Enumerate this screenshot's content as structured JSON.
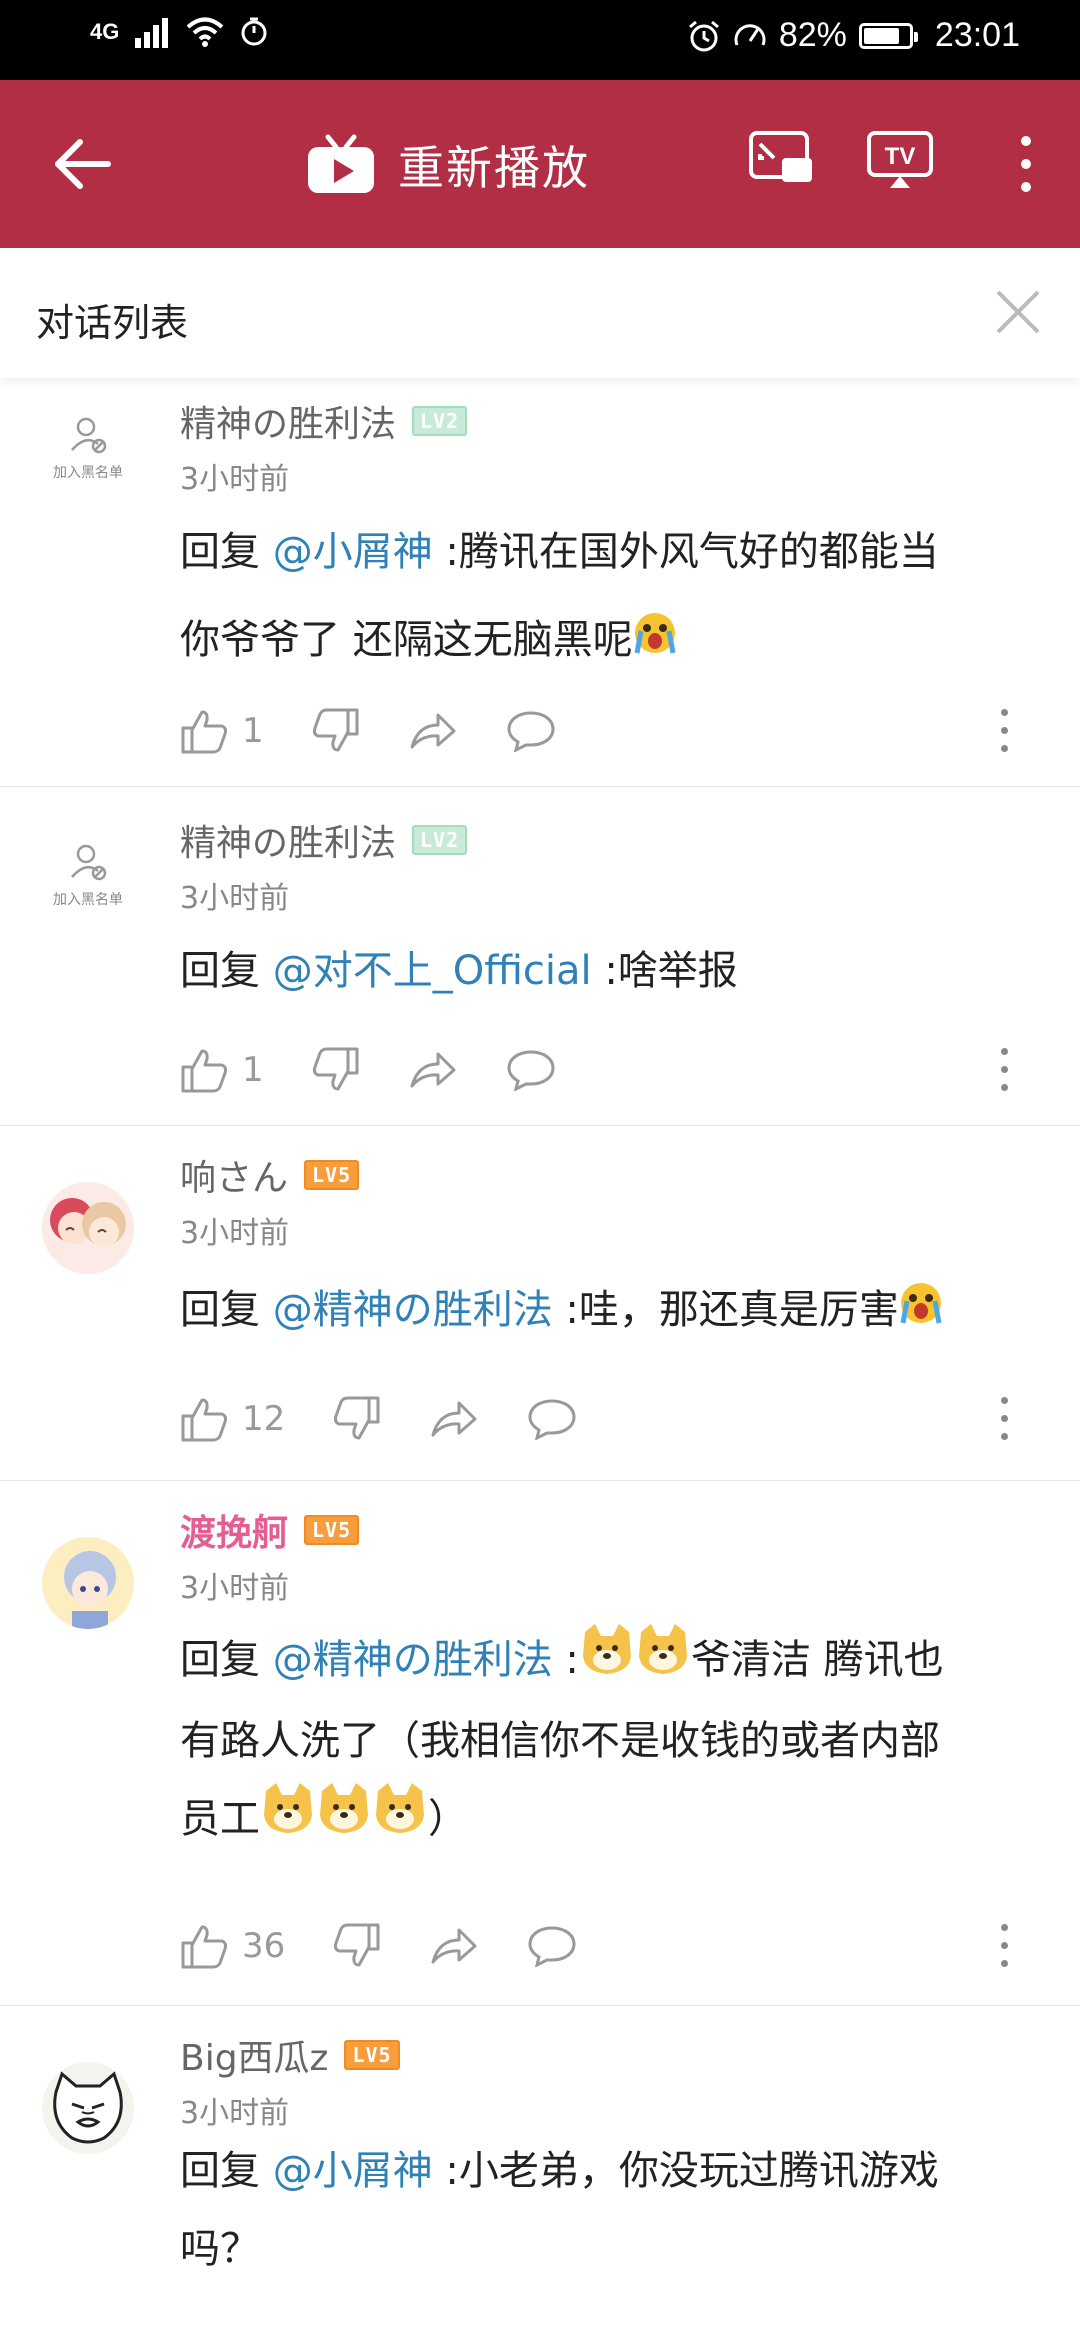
{
  "status_bar": {
    "network": "4G",
    "battery": "82%",
    "battery_level": 0.82,
    "time": "23:01"
  },
  "app_bar": {
    "title": "重新播放"
  },
  "dialog": {
    "title": "对话列表"
  },
  "comments": [
    {
      "user": "精神の胜利法",
      "level": "LV2",
      "avatar": "default-user-icon",
      "blacklist_label": "加入黑名单",
      "time": "3小时前",
      "reply_prefix": "回复 ",
      "mention": "@小屑神",
      "text_line1": " :腾讯在国外风气好的都能当",
      "text_line2": "你爷爷了 还隔这无脑黑呢",
      "likes": "1"
    },
    {
      "user": "精神の胜利法",
      "level": "LV2",
      "avatar": "default-user-icon",
      "blacklist_label": "加入黑名单",
      "time": "3小时前",
      "reply_prefix": "回复 ",
      "mention": "@对不上_Official",
      "text_line1": " :啥举报",
      "likes": "1"
    },
    {
      "user": "响さん",
      "level": "LV5",
      "avatar": "anime-avatar",
      "time": "3小时前",
      "reply_prefix": "回复 ",
      "mention": "@精神の胜利法",
      "text_line1": " :哇，那还真是厉害",
      "likes": "12"
    },
    {
      "user": "渡挽舸",
      "level": "LV5",
      "avatar": "anime-avatar",
      "time": "3小时前",
      "reply_prefix": "回复 ",
      "mention": "@精神の胜利法",
      "text_line1_a": " :",
      "text_line1_b": "爷清洁 腾讯也",
      "text_line2": "有路人洗了（我相信你不是收钱的或者内部",
      "text_line3_a": "员工",
      "text_line3_b": "）",
      "likes": "36"
    },
    {
      "user": "Big西瓜z",
      "level": "LV5",
      "avatar": "cat-avatar",
      "time": "3小时前",
      "reply_prefix": "回复 ",
      "mention": "@小屑神",
      "text_line1": " :小老弟，你没玩过腾讯游戏",
      "text_line2": "吗？"
    }
  ]
}
